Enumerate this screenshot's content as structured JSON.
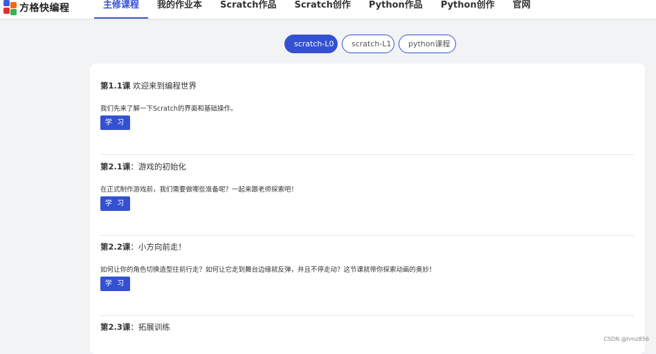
{
  "header": {
    "logo_text": "方格快编程",
    "nav": [
      {
        "label": "主修课程",
        "active": true
      },
      {
        "label": "我的作业本",
        "active": false
      },
      {
        "label": "Scratch作品",
        "active": false
      },
      {
        "label": "Scratch创作",
        "active": false
      },
      {
        "label": "Python作品",
        "active": false
      },
      {
        "label": "Python创作",
        "active": false
      },
      {
        "label": "官网",
        "active": false
      }
    ]
  },
  "tabs": [
    {
      "label": "scratch-L0",
      "active": true
    },
    {
      "label": "scratch-L1",
      "active": false
    },
    {
      "label": "python课程",
      "active": false
    }
  ],
  "lessons": [
    {
      "number": "第1.1课",
      "title": " 欢迎来到编程世界",
      "desc": "我们先来了解一下Scratch的界面和基础操作。",
      "button": "学 习"
    },
    {
      "number": "第2.1课",
      "title": "：游戏的初始化",
      "desc": "在正式制作游戏前，我们需要做哪些准备呢？一起来跟老师探索吧！",
      "button": "学 习"
    },
    {
      "number": "第2.2课",
      "title": "：小方向前走！",
      "desc": "如何让你的角色切换造型往前行走？如何让它走到舞台边缘就反弹，并且不停走动？这节课就带你探索动画的奥妙！",
      "button": "学 习"
    },
    {
      "number": "第2.3课",
      "title": "：拓展训练",
      "desc": "",
      "button": ""
    }
  ],
  "watermark": "CSDN @hmz856",
  "colors": {
    "accent": "#3451d1",
    "background": "#f2f3f5"
  }
}
